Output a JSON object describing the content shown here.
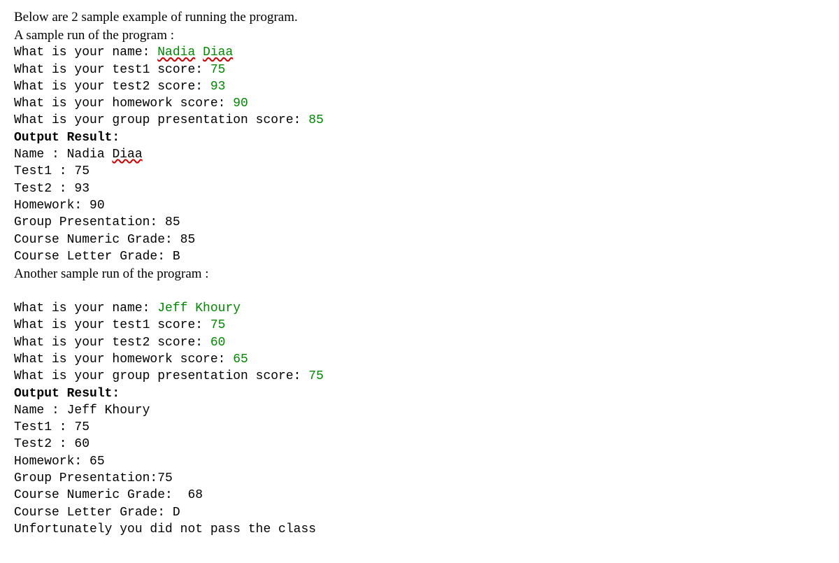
{
  "intro": "Below are 2 sample example of running the program.",
  "sample1": {
    "heading": "A sample run of the program :",
    "prompts": {
      "name_label": "What is your name: ",
      "name_first": "Nadia",
      "name_space": " ",
      "name_last": "Diaa",
      "test1_label": "What is your test1 score:",
      "test1_value": " 75",
      "test2_label": "What is your test2 score:",
      "test2_value": " 93",
      "hw_label": "What is your homework score:",
      "hw_value": " 90",
      "gp_label": "What is your group presentation score:",
      "gp_value": " 85"
    },
    "output_heading": "Output Result:",
    "output": {
      "name_label": "Name : Nadia ",
      "name_last": "Diaa",
      "test1": "Test1 : 75",
      "test2": "Test2 : 93",
      "hw": "Homework: 90",
      "gp": "Group Presentation: 85",
      "numeric": "Course Numeric Grade: 85",
      "letter": "Course Letter Grade: B"
    }
  },
  "sample2": {
    "heading": "Another sample run of the program :",
    "prompts": {
      "name_label": "What is your name:",
      "name_value": " Jeff Khoury",
      "test1_label": "What is your test1 score:",
      "test1_value": " 75",
      "test2_label": "What is your test2 score:",
      "test2_value": " 60",
      "hw_label": "What is your homework score:",
      "hw_value": " 65",
      "gp_label": "What is your group presentation score:",
      "gp_value": " 75"
    },
    "output_heading": "Output Result:",
    "output": {
      "name": "Name : Jeff Khoury",
      "test1": "Test1 : 75",
      "test2": "Test2 : 60",
      "hw": "Homework: 65",
      "gp": "Group Presentation:75",
      "numeric": "Course Numeric Grade:  68",
      "letter": "Course Letter Grade: D",
      "fail": "Unfortunately you did not pass the class"
    }
  }
}
